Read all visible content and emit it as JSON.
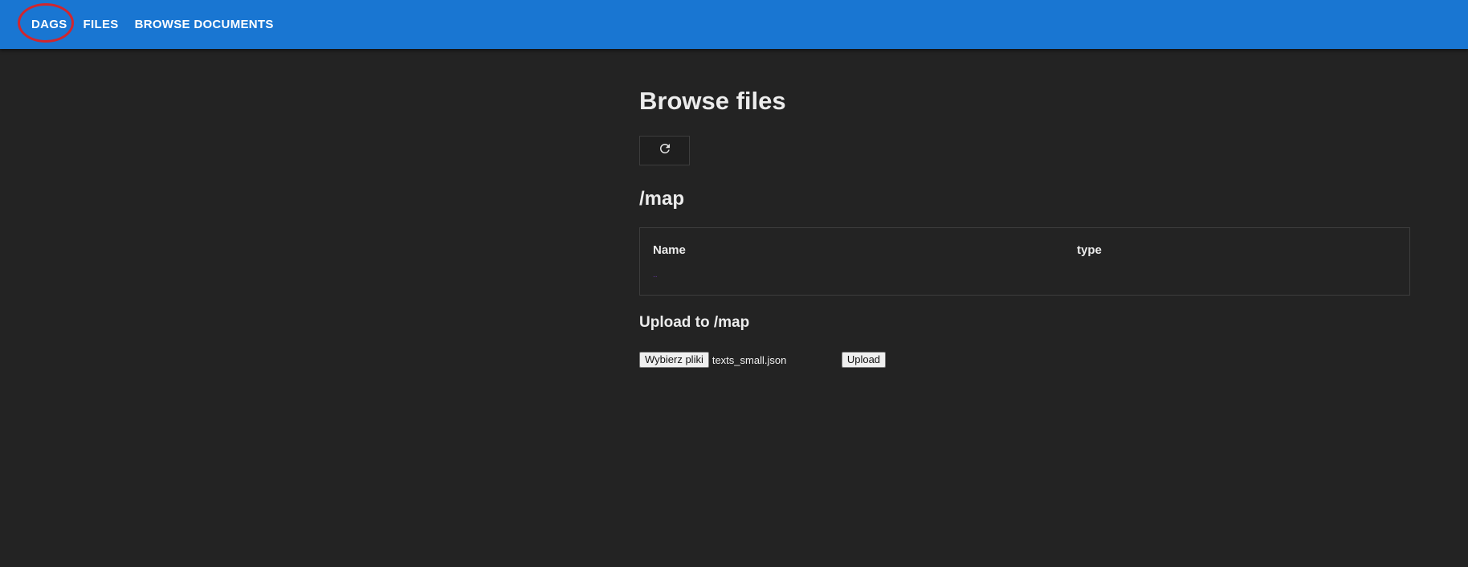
{
  "nav": {
    "items": [
      {
        "label": "DAGS"
      },
      {
        "label": "FILES"
      },
      {
        "label": "BROWSE DOCUMENTS"
      }
    ],
    "highlight_color": "#d0262e",
    "bar_color": "#1976d2"
  },
  "page": {
    "title": "Browse files",
    "refresh_icon": "refresh-icon",
    "path": "/map"
  },
  "table": {
    "columns": [
      "Name",
      "type"
    ],
    "rows": [
      {
        "name": "..",
        "type": ""
      }
    ]
  },
  "upload": {
    "title": "Upload to /map",
    "choose_label": "Wybierz pliki",
    "selected_file": "texts_small.json",
    "upload_label": "Upload"
  }
}
